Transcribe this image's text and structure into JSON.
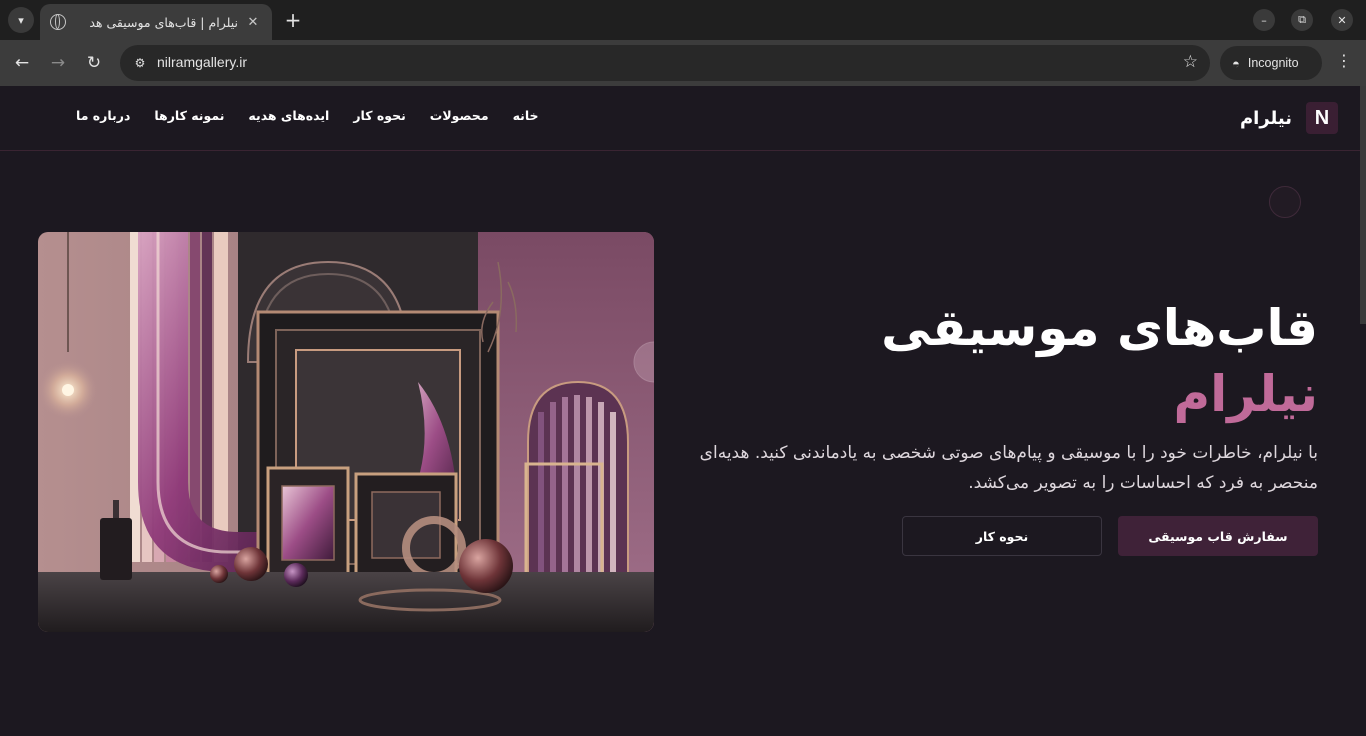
{
  "browser": {
    "tab_title": "نیلرام | قاب‌های موسیقی هد",
    "url": "nilramgallery.ir",
    "incognito_label": "Incognito"
  },
  "header": {
    "brand_logo": "N",
    "brand_name": "نیلرام",
    "nav": [
      "خانه",
      "محصولات",
      "نحوه کار",
      "ایده‌های هدیه",
      "نمونه کارها",
      "درباره ما"
    ]
  },
  "hero": {
    "title": "قاب‌های موسیقی",
    "subtitle": "نیلرام",
    "description": "با نیلرام، خاطرات خود را با موسیقی و پیام‌های صوتی شخصی به یادماندنی کنید. هدیه‌ای منحصر به فرد که احساسات را به تصویر می‌کشد.",
    "primary_button": "سفارش قاب موسیقی",
    "secondary_button": "نحوه کار"
  },
  "colors": {
    "page_bg": "#1c1820",
    "accent": "#c06a99",
    "button_primary": "#3f2238"
  }
}
